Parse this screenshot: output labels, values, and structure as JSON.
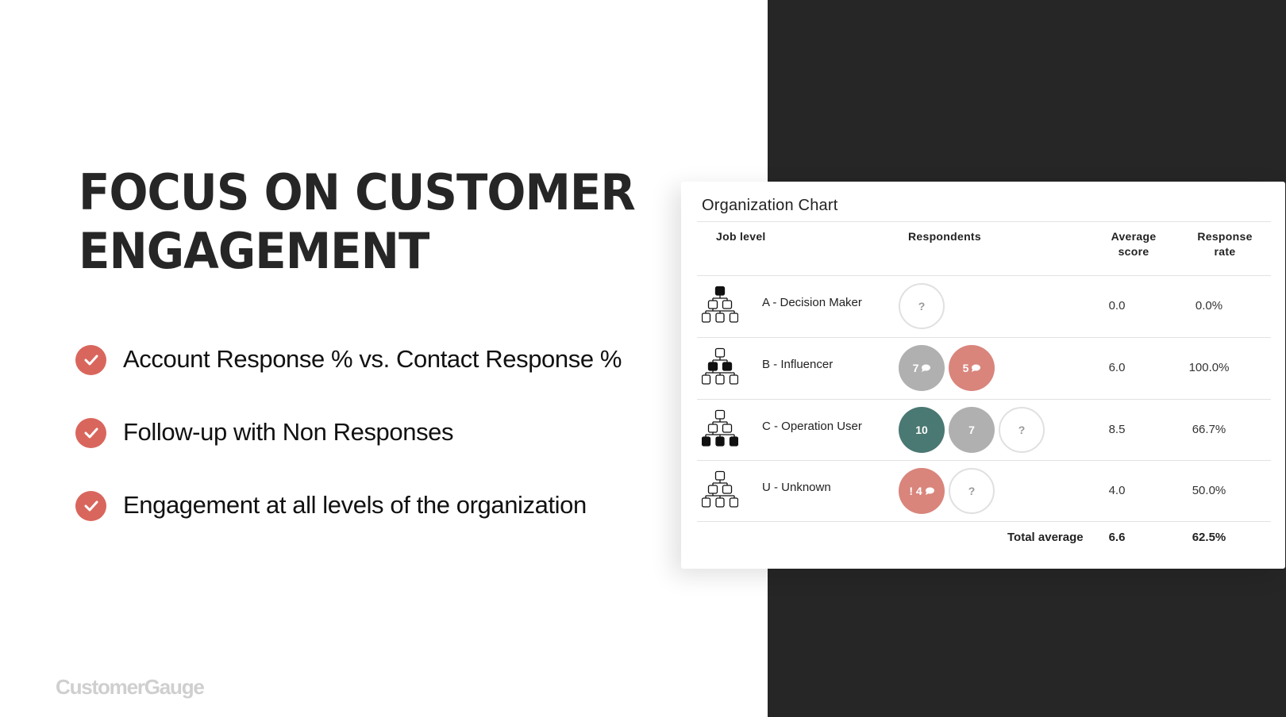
{
  "slide": {
    "title_line1": "FOCUS ON CUSTOMER",
    "title_line2": "ENGAGEMENT",
    "bullets": [
      {
        "icon": "check-circle-icon",
        "text": "Account Response % vs. Contact Response %"
      },
      {
        "icon": "check-circle-icon",
        "text": "Follow-up with Non Responses"
      },
      {
        "icon": "check-circle-icon",
        "text": "Engagement at all levels of the organization"
      }
    ],
    "logo": "CustomerGauge",
    "accent_color": "#d9665d"
  },
  "org_chart": {
    "title": "Organization Chart",
    "columns": {
      "job_level": "Job level",
      "respondents": "Respondents",
      "average_score_line1": "Average",
      "average_score_line2": "score",
      "response_rate_line1": "Response",
      "response_rate_line2": "rate"
    },
    "rows": [
      {
        "icon": "org-hierarchy-top-level-icon",
        "code": "A",
        "label": "A  - Decision Maker",
        "respondents": [
          {
            "type": "empty",
            "text": "?"
          }
        ],
        "average_score": "0.0",
        "response_rate": "0.0%"
      },
      {
        "icon": "org-hierarchy-middle-level-icon",
        "code": "B",
        "label": "B  - Influencer",
        "respondents": [
          {
            "type": "gray",
            "text": "7",
            "comment": true
          },
          {
            "type": "salmon",
            "text": "5",
            "comment": true
          }
        ],
        "average_score": "6.0",
        "response_rate": "100.0%"
      },
      {
        "icon": "org-hierarchy-bottom-level-icon",
        "code": "C",
        "label": "C  - Operation User",
        "respondents": [
          {
            "type": "teal",
            "text": "10",
            "comment": false
          },
          {
            "type": "gray",
            "text": "7",
            "comment": false
          },
          {
            "type": "empty",
            "text": "?"
          }
        ],
        "average_score": "8.5",
        "response_rate": "66.7%"
      },
      {
        "icon": "org-hierarchy-unknown-level-icon",
        "code": "U",
        "label": "U  - Unknown",
        "respondents": [
          {
            "type": "salmon",
            "text": "! 4",
            "comment": true
          },
          {
            "type": "empty",
            "text": "?"
          }
        ],
        "average_score": "4.0",
        "response_rate": "50.0%"
      }
    ],
    "total": {
      "label": "Total average",
      "average_score": "6.6",
      "response_rate": "62.5%"
    },
    "colors": {
      "promoter": "#4a7872",
      "passive": "#b0b0b0",
      "detractor": "#d9857c",
      "no_response_border": "#e0e0e0"
    }
  }
}
